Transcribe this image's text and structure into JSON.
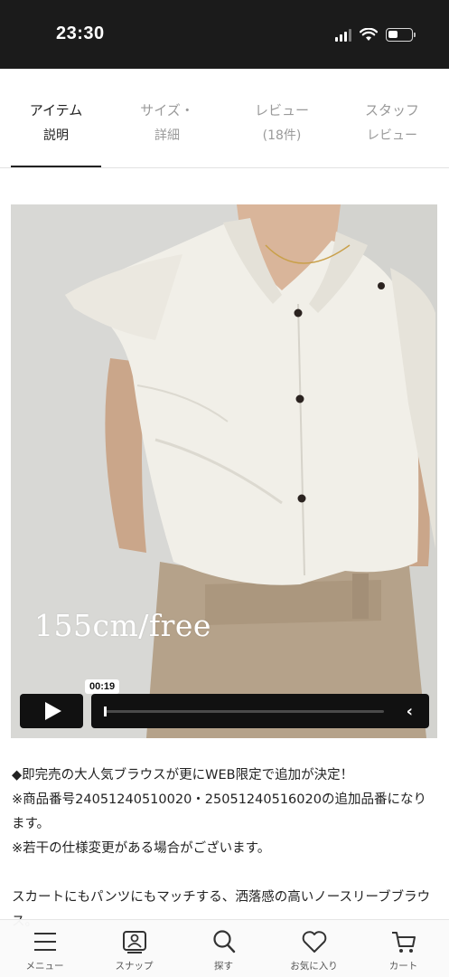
{
  "status_bar": {
    "time": "23:30"
  },
  "tabs": [
    {
      "line1": "アイテム",
      "line2": "説明",
      "active": true
    },
    {
      "line1": "サイズ・",
      "line2": "詳細",
      "active": false
    },
    {
      "line1": "レビュー",
      "line2": "(18件)",
      "active": false
    },
    {
      "line1": "スタッフ",
      "line2": "レビュー",
      "active": false
    }
  ],
  "video": {
    "overlay_text": "155cm/free",
    "current_time": "00:19",
    "progress": 0.0,
    "chevron": "‹"
  },
  "description": {
    "line1": "◆即完売の大人気ブラウスが更にWEB限定で追加が決定！",
    "line2": "※商品番号24051240510020・25051240516020の追加品番になります。",
    "line3": "※若干の仕様変更がある場合がございます。",
    "line4": "スカートにもパンツにもマッチする、洒落感の高いノースリーブブラウス。"
  },
  "bottom_nav": [
    {
      "label": "メニュー",
      "icon": "menu-icon"
    },
    {
      "label": "スナップ",
      "icon": "snap-icon"
    },
    {
      "label": "探す",
      "icon": "search-icon"
    },
    {
      "label": "お気に入り",
      "icon": "heart-icon"
    },
    {
      "label": "カート",
      "icon": "cart-icon"
    }
  ],
  "colors": {
    "status_bg": "#1b1b1b",
    "text": "#222222",
    "inactive_tab": "#9a9a9a",
    "player_bg": "#111111"
  }
}
